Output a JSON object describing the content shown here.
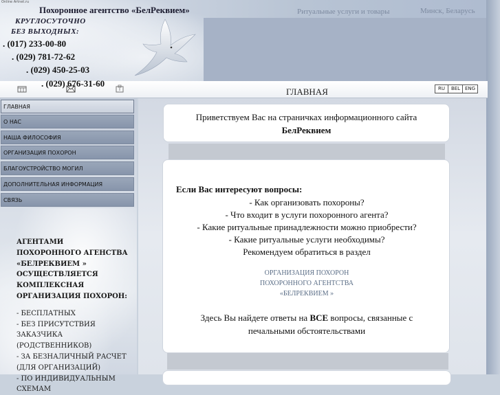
{
  "header": {
    "tiny_label": "Online Artnet.ru",
    "agency_name": "Похоронное агентство  «БелРеквием»",
    "services_tag": "Ритуальные услуги и товары",
    "city": "Минск, Беларусь",
    "around_clock": "КРУГЛОСУТОЧНО",
    "no_days_off": "БЕЗ ВЫХОДНЫХ:",
    "phones": [
      ". (017) 233-00-80",
      ". (029) 781-72-62",
      ". (029) 450-25-03",
      ". (029) 676-31-60"
    ]
  },
  "toolbar": {
    "title": "ГЛАВНАЯ",
    "icons": [
      "home-icon",
      "mail-icon",
      "map-icon"
    ],
    "languages": [
      "RU",
      "BEL",
      "ENG"
    ]
  },
  "sidebar": {
    "items": [
      {
        "label": "ГЛАВНАЯ"
      },
      {
        "label": "О НАС"
      },
      {
        "label": "НАША ФИЛОСОФИЯ"
      },
      {
        "label": "ОРГАНИЗАЦИЯ ПОХОРОН"
      },
      {
        "label": "БЛАГОУСТРОЙСТВО МОГИЛ"
      },
      {
        "label": "ДОПОЛНИТЕЛЬНАЯ ИНФОРМАЦИЯ"
      },
      {
        "label": "СВЯЗЬ"
      }
    ],
    "promo_title": [
      "АГЕНТАМИ",
      "ПОХОРОННОГО АГЕНСТВА",
      "«БЕЛРЕКВИЕМ »",
      "ОСУЩЕСТВЛЯЕТСЯ",
      "КОМПЛЕКСНАЯ",
      "ОРГАНИЗАЦИЯ ПОХОРОН:"
    ],
    "promo_list": [
      "- БЕСПЛАТНЫХ",
      "- БЕЗ ПРИСУТСТВИЯ",
      "ЗАКАЗЧИКА (РОДСТВЕННИКОВ)",
      "- ЗА БЕЗНАЛИЧНЫЙ РАСЧЕТ",
      "(ДЛЯ ОРГАНИЗАЦИЙ)",
      "- ПО ИНДИВИДУАЛЬНЫМ",
      "СХЕМАМ"
    ]
  },
  "main": {
    "greeting_line1": "Приветствуем Вас на страничках информационного сайта",
    "greeting_line2": "БелРеквием",
    "questions_heading": "Если Вас интересуют вопросы:",
    "questions": [
      "- Как организовать похороны?",
      "- Что входит в услуги похоронного агента?",
      "- Какие ритуальные принадлежности можно приобрести?",
      "- Какие ритуальные услуги необходимы?"
    ],
    "recommend": "Рекомендуем обратиться в раздел",
    "org_link": [
      "ОРГАНИЗАЦИЯ ПОХОРОН",
      "ПОХОРОННОГО АГЕНТСТВА",
      "«БЕЛРЕКВИЕМ »"
    ],
    "answers_pre": "Здесь Вы найдете ответы на ",
    "answers_bold": "ВСЕ",
    "answers_post": " вопросы, связанные с",
    "answers_line2": "печальными обстоятельствами"
  }
}
